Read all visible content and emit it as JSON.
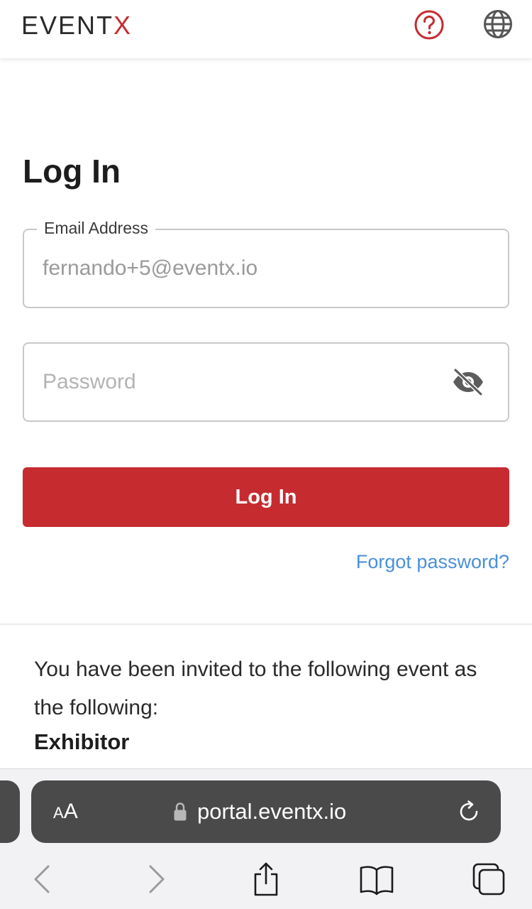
{
  "header": {
    "logo_main": "EVENT",
    "logo_accent": "X",
    "help_icon": "question-circle-icon",
    "language_icon": "globe-icon"
  },
  "login": {
    "title": "Log In",
    "email": {
      "label": "Email Address",
      "value": "fernando+5@eventx.io"
    },
    "password": {
      "placeholder": "Password",
      "toggle_icon": "eye-slash-icon"
    },
    "submit_label": "Log In",
    "forgot_label": "Forgot password?"
  },
  "invite": {
    "text": "You have been invited to the following event as the following:",
    "role": "Exhibitor"
  },
  "browser": {
    "aa_small": "A",
    "aa_large": "A",
    "url": "portal.eventx.io"
  },
  "colors": {
    "brand": "#c62b30",
    "link": "#4a90d9"
  }
}
